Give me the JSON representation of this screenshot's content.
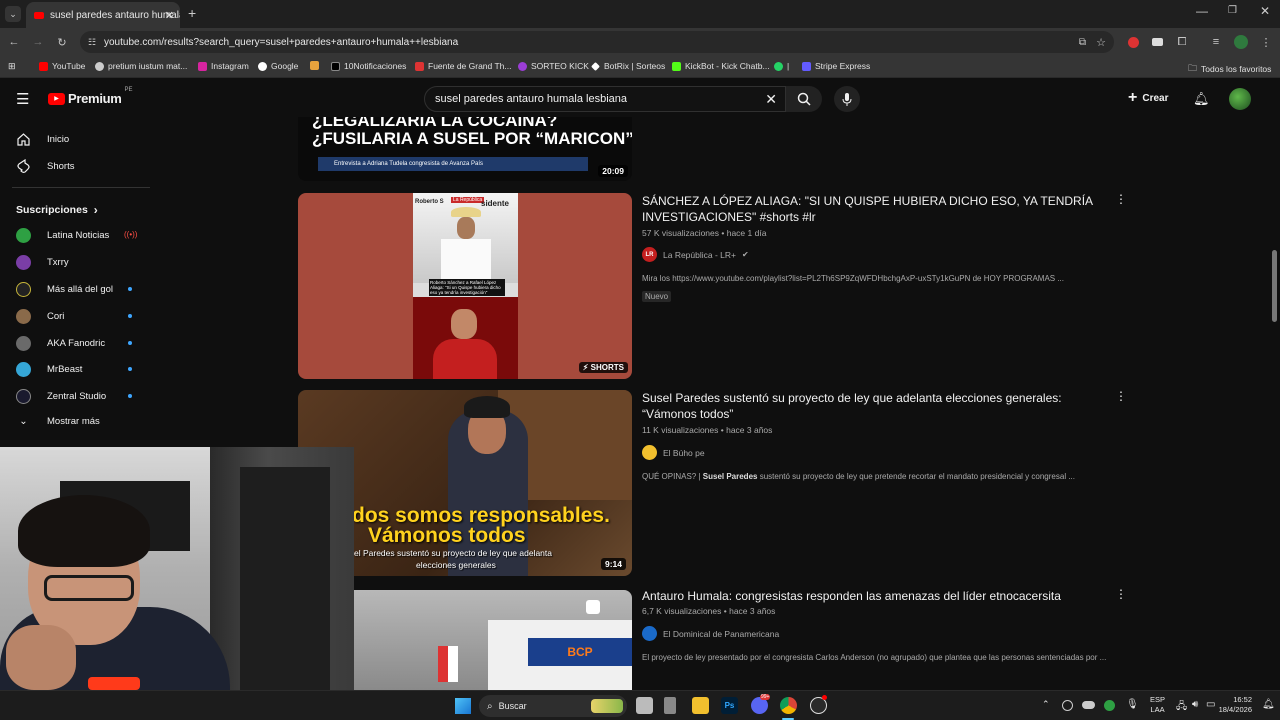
{
  "browser": {
    "tab_title": "susel paredes antauro humala l",
    "url": "youtube.com/results?search_query=susel+paredes+antauro+humala++lesbiana",
    "bookmarks": [
      "YouTube",
      "pretium iustum mat...",
      "Instagram",
      "Google",
      "10Notificaciones",
      "Fuente de Grand Th...",
      "SORTEO KICK",
      "BotRix | Sorteos",
      "KickBot - Kick Chatb...",
      "|",
      "Stripe Express"
    ],
    "all_bookmarks": "Todos los favoritos"
  },
  "youtube": {
    "logo_text": "Premium",
    "region": "PE",
    "search_value": "susel paredes antauro humala  lesbiana",
    "create_label": "Crear"
  },
  "sidebar": {
    "home": "Inicio",
    "shorts": "Shorts",
    "subs_header": "Suscripciones",
    "subs_chevron": "›",
    "subscriptions": [
      "Latina Noticias",
      "Txrry",
      "Más allá del gol",
      "Cori",
      "AKA Fanodric",
      "MrBeast",
      "Zentral Studio"
    ],
    "show_more": "Mostrar más"
  },
  "results": [
    {
      "thumb_text_1": "¿LEGALIZARIA LA COCAINA?",
      "thumb_text_2": "¿FUSILARIA A SUSEL POR “MARICON”?",
      "thumb_caption": "Entrevista a Adriana Tudela congresista de Avanza País",
      "duration": "20:09"
    },
    {
      "title": "SÁNCHEZ A LÓPEZ ALIAGA: \"SI UN QUISPE HUBIERA DICHO ESO, YA TENDRÍA INVESTIGACIONES\" #shorts #lr",
      "views": "57 K visualizaciones",
      "age": "hace 1 día",
      "channel": "La República - LR+",
      "channel_badge": "LR",
      "description": "Mira los https://www.youtube.com/playlist?list=PL2Th6SP9ZqWFDHbchgAxP-uxSTy1kGuPN de HOY PROGRAMAS ...",
      "badge": "Nuevo",
      "shorts_label": "SHORTS",
      "thumb_tag": "La República",
      "thumb_names": "Roberto S",
      "thumb_word": "sidente",
      "thumb_caption": "Roberto Sánchez a Rafael López Aliaga: \"Si un Quispe hubiera dicho eso ya tendría investigación\""
    },
    {
      "title": "Susel Paredes sustentó su proyecto de ley que adelanta elecciones generales: “Vámonos todos”",
      "views": "11 K visualizaciones",
      "age": "hace 3 años",
      "channel": "El Búho pe",
      "description_prefix": "QUÉ OPINAS? | ",
      "description_bold": "Susel Paredes",
      "description_rest": " sustentó su proyecto de ley que pretende recortar el mandato presidencial y congresal ...",
      "thumb_text_1": "dos somos responsables.",
      "thumb_text_2": "Vámonos todos",
      "thumb_caption_1": "el Paredes sustentó su proyecto de ley que adelanta",
      "thumb_caption_2": "elecciones generales",
      "duration": "9:14"
    },
    {
      "title": "Antauro Humala: congresistas responden las amenazas del líder etnocacersita",
      "views": "6,7 K visualizaciones",
      "age": "hace 3 años",
      "channel": "El Dominical de Panamericana",
      "description": "El proyecto de ley presentado por el congresista Carlos Anderson (no agrupado) que plantea que las personas sentenciadas por ...",
      "thumb_sign": "BCP"
    }
  ],
  "taskbar": {
    "search_label": "Buscar",
    "lang_1": "ESP",
    "lang_2": "LAA",
    "time": "16:52",
    "date": "18/4/2026",
    "notif_count": "99+"
  }
}
